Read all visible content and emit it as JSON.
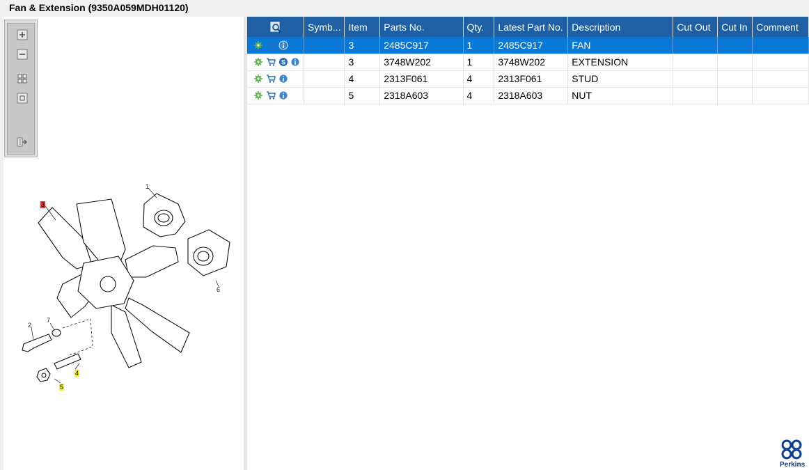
{
  "window": {
    "title": "Fan & Extension (9350A059MDH01120)"
  },
  "toolbar": {
    "buttons": [
      {
        "name": "zoom-in",
        "icon": "plus-icon"
      },
      {
        "name": "zoom-out",
        "icon": "minus-icon"
      },
      {
        "name": "fit-all",
        "icon": "grid-icon"
      },
      {
        "name": "actual-size",
        "icon": "square-icon"
      },
      {
        "name": "export",
        "icon": "export-icon"
      }
    ]
  },
  "diagram": {
    "callouts": [
      "1",
      "2",
      "3",
      "4",
      "5",
      "6",
      "7"
    ]
  },
  "table": {
    "headers": [
      "Symb...",
      "Item",
      "Parts No.",
      "Qty.",
      "Latest Part No.",
      "Description",
      "Cut Out",
      "Cut In",
      "Comment"
    ],
    "rows": [
      {
        "symbol": "",
        "item": "3",
        "part_no": "2485C917",
        "qty": "1",
        "latest": "2485C917",
        "desc": "FAN",
        "cut_out": "",
        "cut_in": "",
        "comment": "",
        "has_s": false,
        "selected": true
      },
      {
        "symbol": "",
        "item": "3",
        "part_no": "3748W202",
        "qty": "1",
        "latest": "3748W202",
        "desc": "EXTENSION",
        "cut_out": "",
        "cut_in": "",
        "comment": "",
        "has_s": true,
        "selected": false
      },
      {
        "symbol": "",
        "item": "4",
        "part_no": "2313F061",
        "qty": "4",
        "latest": "2313F061",
        "desc": "STUD",
        "cut_out": "",
        "cut_in": "",
        "comment": "",
        "has_s": false,
        "selected": false
      },
      {
        "symbol": "",
        "item": "5",
        "part_no": "2318A603",
        "qty": "4",
        "latest": "2318A603",
        "desc": "NUT",
        "cut_out": "",
        "cut_in": "",
        "comment": "",
        "has_s": false,
        "selected": false
      }
    ]
  },
  "brand": {
    "name": "Perkins",
    "color": "#0b3d91"
  },
  "colors": {
    "header": "#1f5fa3",
    "selected": "#0a78d7",
    "highlight_red": "#e8393a",
    "highlight_yellow": "#f6ee29"
  }
}
